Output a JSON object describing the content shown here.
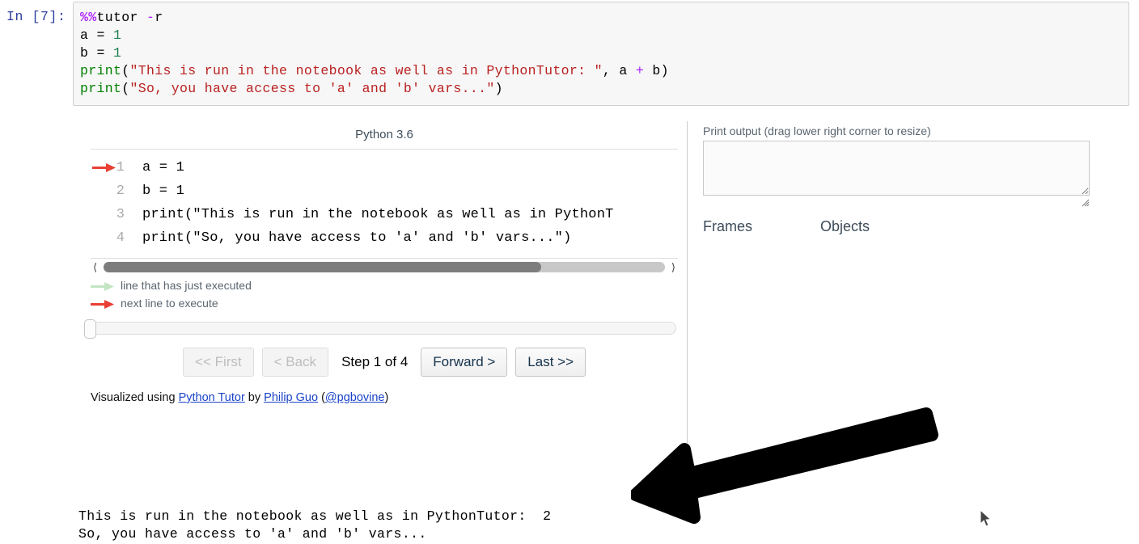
{
  "notebook": {
    "prompt": "In [7]:",
    "code_lines": [
      [
        {
          "t": "magic",
          "s": "%%"
        },
        {
          "t": "plain",
          "s": "tutor "
        },
        {
          "t": "op",
          "s": "-"
        },
        {
          "t": "plain",
          "s": "r"
        }
      ],
      [
        {
          "t": "plain",
          "s": "a = "
        },
        {
          "t": "num",
          "s": "1"
        }
      ],
      [
        {
          "t": "plain",
          "s": "b = "
        },
        {
          "t": "num",
          "s": "1"
        }
      ],
      [
        {
          "t": "fn",
          "s": "print"
        },
        {
          "t": "plain",
          "s": "("
        },
        {
          "t": "str",
          "s": "\"This is run in the notebook as well as in PythonTutor: \""
        },
        {
          "t": "plain",
          "s": ", a "
        },
        {
          "t": "op",
          "s": "+"
        },
        {
          "t": "plain",
          "s": " b)"
        }
      ],
      [
        {
          "t": "fn",
          "s": "print"
        },
        {
          "t": "plain",
          "s": "("
        },
        {
          "t": "str",
          "s": "\"So, you have access to 'a' and 'b' vars...\""
        },
        {
          "t": "plain",
          "s": ")"
        }
      ]
    ]
  },
  "pytutor": {
    "language_label": "Python 3.6",
    "code_lines": [
      {
        "num": "1",
        "text": "a = 1",
        "arrow": "next"
      },
      {
        "num": "2",
        "text": "b = 1",
        "arrow": "none"
      },
      {
        "num": "3",
        "text": "print(\"This is run in the notebook as well as in PythonT",
        "arrow": "none"
      },
      {
        "num": "4",
        "text": "print(\"So, you have access to 'a' and 'b' vars...\")",
        "arrow": "none"
      }
    ],
    "legend": [
      {
        "marker": "executed-arrow-icon",
        "label": "line that has just executed"
      },
      {
        "marker": "next-arrow-icon",
        "label": "next line to execute"
      }
    ],
    "controls": {
      "first_label": "<< First",
      "back_label": "< Back",
      "step_counter": "Step 1 of 4",
      "forward_label": "Forward >",
      "last_label": "Last >>"
    },
    "credit": {
      "prefix": "Visualized using ",
      "tool_link": "Python Tutor",
      "middle": " by ",
      "author_link": "Philip Guo",
      "open_paren": " (",
      "handle_link": "@pgbovine",
      "close_paren": ")"
    },
    "right_pane": {
      "print_output_label": "Print output (drag lower right corner to resize)",
      "print_output_value": "",
      "frames_heading": "Frames",
      "objects_heading": "Objects"
    },
    "colors": {
      "next_arrow": "#e93f34",
      "executed_arrow": "#c3e5c3",
      "link": "#1a43c8",
      "scrollbar_thumb": "#7d7d7d"
    }
  },
  "stdout": {
    "lines": [
      "This is run in the notebook as well as in PythonTutor:  2",
      "So, you have access to 'a' and 'b' vars..."
    ]
  }
}
